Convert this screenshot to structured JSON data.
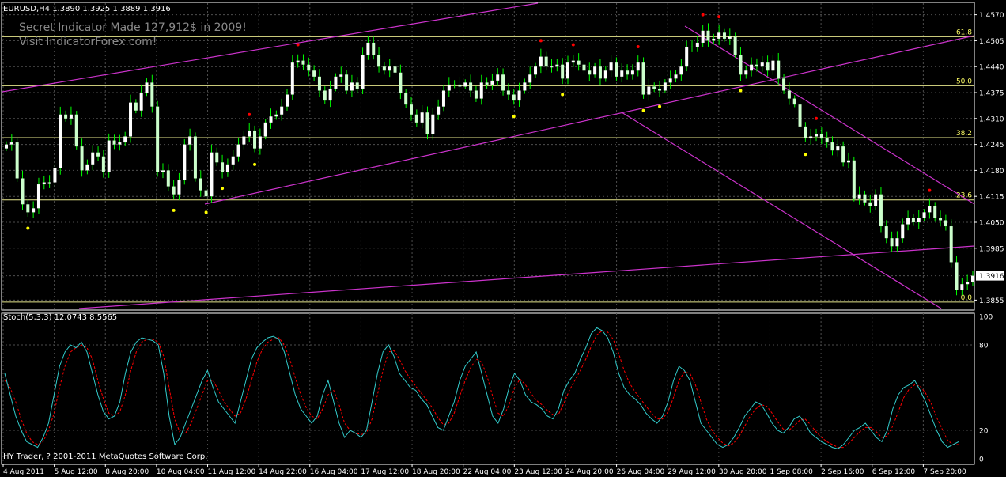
{
  "header": {
    "symbol_line": "EURUSD,H4  1.3890 1.3925 1.3889 1.3916",
    "watermark_1": "Secret Indicator Made 127,912$ in 2009!",
    "watermark_2": "Visit IndicatorForex.com!"
  },
  "footer": {
    "copyright": "HY Trader, ? 2001-2011 MetaQuotes Software Corp."
  },
  "colors": {
    "background": "#000000",
    "frame": "#ffffff",
    "grid": "#4d4d4d",
    "bull_candle": "#ffffff",
    "bear_candle": "#ccffcc",
    "wick": "#00ff00",
    "trendline": "#cc33cc",
    "fib": "#e6e68c",
    "fractal_up": "#ff0000",
    "fractal_down": "#ffff00",
    "stoch_main": "#33cccc",
    "stoch_signal": "#ff0000",
    "text": "#ffffff",
    "fib_label": "#ffff66"
  },
  "chart_data": [
    {
      "type": "candlestick",
      "title": "EURUSD,H4",
      "ylim": [
        1.383,
        1.4595
      ],
      "price_ticks": [
        "1.4570",
        "1.4505",
        "1.4440",
        "1.4375",
        "1.4310",
        "1.4245",
        "1.4180",
        "1.4115",
        "1.4050",
        "1.3985",
        "1.3916",
        "1.3855"
      ],
      "current_price": "1.3916",
      "x_labels": [
        "4 Aug 2011",
        "5 Aug 12:00",
        "8 Aug 20:00",
        "10 Aug 04:00",
        "11 Aug 12:00",
        "14 Aug 22:00",
        "16 Aug 04:00",
        "17 Aug 12:00",
        "18 Aug 20:00",
        "22 Aug 04:00",
        "23 Aug 12:00",
        "24 Aug 20:00",
        "26 Aug 04:00",
        "29 Aug 12:00",
        "30 Aug 20:00",
        "1 Sep 08:00",
        "2 Sep 16:00",
        "6 Sep 12:00",
        "7 Sep 20:00"
      ],
      "fib_levels": [
        {
          "label": "61.8",
          "price": 1.4515
        },
        {
          "label": "50.0",
          "price": 1.4392
        },
        {
          "label": "38.2",
          "price": 1.4262
        },
        {
          "label": "23.6",
          "price": 1.4106
        },
        {
          "label": "0.0",
          "price": 1.385
        }
      ],
      "close": [
        1.4245,
        1.425,
        1.416,
        1.4095,
        1.4075,
        1.4085,
        1.4145,
        1.415,
        1.415,
        1.4185,
        1.432,
        1.431,
        1.432,
        1.424,
        1.418,
        1.4195,
        1.4225,
        1.4215,
        1.4175,
        1.4255,
        1.4245,
        1.425,
        1.4265,
        1.435,
        1.433,
        1.4375,
        1.44,
        1.434,
        1.4175,
        1.418,
        1.414,
        1.412,
        1.4155,
        1.4245,
        1.4265,
        1.416,
        1.413,
        1.4115,
        1.4225,
        1.42,
        1.4175,
        1.4195,
        1.4215,
        1.4245,
        1.4265,
        1.428,
        1.4235,
        1.4265,
        1.43,
        1.4315,
        1.432,
        1.434,
        1.437,
        1.445,
        1.4455,
        1.4445,
        1.443,
        1.4415,
        1.438,
        1.4355,
        1.4385,
        1.4415,
        1.442,
        1.438,
        1.44,
        1.4385,
        1.447,
        1.45,
        1.447,
        1.444,
        1.443,
        1.444,
        1.4425,
        1.4375,
        1.4345,
        1.432,
        1.43,
        1.4325,
        1.427,
        1.432,
        1.434,
        1.438,
        1.4395,
        1.4395,
        1.439,
        1.44,
        1.438,
        1.436,
        1.44,
        1.4395,
        1.4405,
        1.442,
        1.438,
        1.437,
        1.4355,
        1.438,
        1.44,
        1.442,
        1.444,
        1.4465,
        1.444,
        1.444,
        1.4445,
        1.441,
        1.445,
        1.4455,
        1.4445,
        1.443,
        1.442,
        1.444,
        1.441,
        1.443,
        1.445,
        1.4415,
        1.443,
        1.442,
        1.443,
        1.445,
        1.437,
        1.439,
        1.4385,
        1.438,
        1.44,
        1.441,
        1.442,
        1.444,
        1.449,
        1.449,
        1.45,
        1.453,
        1.4505,
        1.451,
        1.4525,
        1.451,
        1.4515,
        1.447,
        1.442,
        1.443,
        1.4445,
        1.444,
        1.445,
        1.443,
        1.4455,
        1.441,
        1.438,
        1.436,
        1.4345,
        1.429,
        1.426,
        1.4265,
        1.427,
        1.426,
        1.425,
        1.423,
        1.424,
        1.42,
        1.4205,
        1.411,
        1.412,
        1.41,
        1.409,
        1.412,
        1.404,
        1.401,
        1.399,
        1.401,
        1.4045,
        1.406,
        1.405,
        1.406,
        1.4075,
        1.409,
        1.406,
        1.4055,
        1.404,
        1.395,
        1.388,
        1.3895,
        1.39,
        1.3916
      ],
      "stochastic": {
        "legend": "Stoch(5,3,3) 12.0743 8.5565",
        "ylim": [
          0,
          100
        ],
        "levels": [
          "100",
          "80",
          "20",
          "0"
        ],
        "main": [
          60,
          45,
          30,
          20,
          12,
          10,
          8,
          15,
          25,
          45,
          65,
          75,
          80,
          78,
          82,
          75,
          60,
          45,
          33,
          28,
          30,
          40,
          60,
          75,
          82,
          85,
          84,
          83,
          80,
          60,
          30,
          10,
          15,
          25,
          35,
          45,
          55,
          62,
          50,
          40,
          35,
          30,
          25,
          40,
          55,
          70,
          78,
          82,
          85,
          86,
          84,
          75,
          60,
          45,
          35,
          30,
          25,
          30,
          45,
          55,
          40,
          25,
          15,
          20,
          18,
          15,
          20,
          40,
          60,
          75,
          80,
          72,
          60,
          55,
          50,
          48,
          42,
          38,
          30,
          22,
          20,
          30,
          40,
          55,
          65,
          70,
          75,
          60,
          45,
          30,
          25,
          35,
          50,
          60,
          55,
          45,
          40,
          38,
          35,
          30,
          28,
          35,
          48,
          55,
          60,
          70,
          78,
          88,
          92,
          90,
          85,
          75,
          60,
          50,
          45,
          42,
          38,
          32,
          28,
          25,
          30,
          40,
          55,
          65,
          62,
          55,
          40,
          25,
          20,
          15,
          10,
          8,
          10,
          15,
          22,
          30,
          35,
          40,
          38,
          32,
          25,
          20,
          18,
          22,
          28,
          30,
          25,
          18,
          15,
          12,
          10,
          8,
          7,
          10,
          15,
          20,
          22,
          25,
          20,
          15,
          12,
          20,
          35,
          45,
          50,
          52,
          55,
          48,
          40,
          30,
          20,
          12,
          8,
          10,
          12
        ],
        "signal": [
          55,
          50,
          40,
          28,
          18,
          12,
          10,
          12,
          20,
          32,
          50,
          65,
          75,
          78,
          80,
          78,
          70,
          55,
          42,
          32,
          30,
          33,
          45,
          62,
          75,
          82,
          84,
          84,
          82,
          72,
          50,
          28,
          18,
          18,
          25,
          35,
          45,
          55,
          55,
          48,
          40,
          35,
          30,
          32,
          42,
          55,
          68,
          77,
          82,
          84,
          85,
          80,
          70,
          57,
          45,
          36,
          30,
          28,
          35,
          45,
          48,
          38,
          25,
          20,
          18,
          17,
          18,
          28,
          45,
          62,
          75,
          76,
          70,
          62,
          56,
          51,
          46,
          41,
          36,
          29,
          24,
          25,
          32,
          44,
          55,
          64,
          70,
          68,
          58,
          44,
          32,
          30,
          38,
          50,
          56,
          52,
          46,
          41,
          38,
          34,
          31,
          31,
          39,
          48,
          55,
          62,
          70,
          79,
          87,
          90,
          89,
          84,
          74,
          62,
          53,
          47,
          42,
          37,
          32,
          28,
          28,
          33,
          43,
          55,
          61,
          60,
          52,
          40,
          28,
          20,
          15,
          11,
          9,
          11,
          16,
          23,
          30,
          35,
          38,
          37,
          32,
          26,
          21,
          20,
          23,
          27,
          28,
          24,
          19,
          15,
          12,
          10,
          8,
          8,
          11,
          15,
          19,
          22,
          22,
          19,
          15,
          16,
          23,
          33,
          43,
          49,
          52,
          51,
          46,
          39,
          29,
          21,
          13,
          10,
          10
        ]
      }
    }
  ]
}
